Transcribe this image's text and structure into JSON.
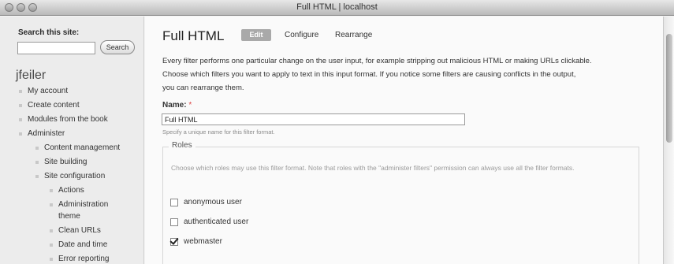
{
  "window": {
    "title": "Full HTML | localhost"
  },
  "sidebar": {
    "search_label": "Search this site:",
    "search_value": "",
    "search_button": "Search",
    "username": "jfeiler",
    "nav": [
      {
        "label": "My account"
      },
      {
        "label": "Create content"
      },
      {
        "label": "Modules from the book"
      },
      {
        "label": "Administer"
      },
      {
        "label": "Content management"
      },
      {
        "label": "Site building"
      },
      {
        "label": "Site configuration"
      },
      {
        "label": "Actions"
      },
      {
        "label": "Administration"
      },
      {
        "label": "theme"
      },
      {
        "label": "Clean URLs"
      },
      {
        "label": "Date and time"
      },
      {
        "label": "Error reporting"
      }
    ]
  },
  "main": {
    "title": "Full HTML",
    "tabs": [
      {
        "label": "Edit",
        "active": true
      },
      {
        "label": "Configure"
      },
      {
        "label": "Rearrange"
      }
    ],
    "description": [
      "Every filter performs one particular change on the user input, for example stripping out malicious HTML or making URLs clickable.",
      "Choose which filters you want to apply to text in this input format. If you notice some filters are causing conflicts in the output,",
      "you can rearrange them."
    ],
    "name_label": "Name:",
    "required_marker": "*",
    "name_value": "Full HTML",
    "name_hint": "Specify a unique name for this filter format.",
    "roles": {
      "legend": "Roles",
      "description": "Choose which roles may use this filter format. Note that roles with the \"administer filters\" permission can always use all the filter formats.",
      "items": [
        {
          "label": "anonymous user",
          "checked": false
        },
        {
          "label": "authenticated user",
          "checked": false
        },
        {
          "label": "webmaster",
          "checked": true
        }
      ]
    }
  }
}
